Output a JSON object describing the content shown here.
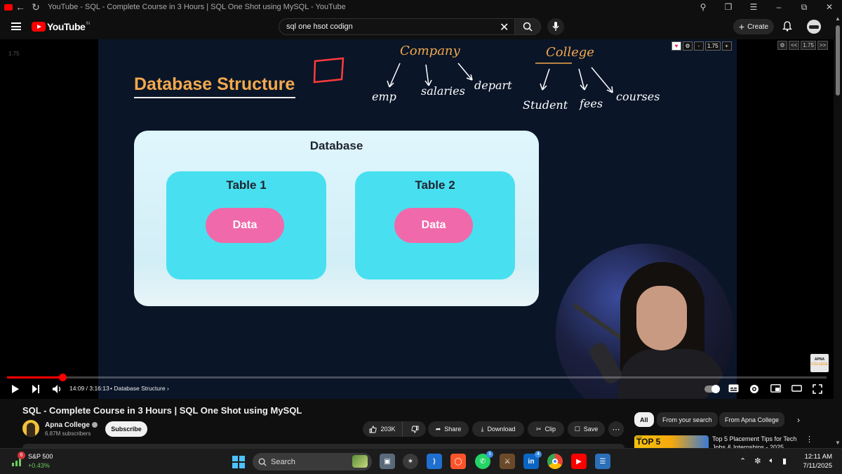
{
  "browser": {
    "title": "YouTube - SQL - Complete Course in 3 Hours | SQL One Shot using MySQL - YouTube"
  },
  "header": {
    "logo_text": "YouTube",
    "logo_region": "IN",
    "search_value": "sql one hsot codign",
    "create_label": "Create"
  },
  "player": {
    "left_speed": "1.75",
    "slide": {
      "title": "Database Structure",
      "database_label": "Database",
      "tables": [
        {
          "label": "Table 1",
          "data_label": "Data"
        },
        {
          "label": "Table 2",
          "data_label": "Data"
        }
      ],
      "annotations": {
        "company": "Company",
        "company_items": [
          "emp",
          "salaries",
          "depart"
        ],
        "college": "College",
        "college_items": [
          "Student",
          "fees",
          "courses"
        ]
      }
    },
    "pen_tools": {
      "minus": "-",
      "speed": "1.75",
      "plus": "+"
    },
    "pen_tools_right": {
      "prev": "<<",
      "speed": "1.75",
      "next": ">>"
    },
    "channel_watermark": {
      "line1": "APNA",
      "line2": "COLLEGE"
    },
    "progress_fraction": 0.0675,
    "time": "14:09 / 3:16:13",
    "chapter": "• Database Structure"
  },
  "video": {
    "title": "SQL - Complete Course in 3 Hours | SQL One Shot using MySQL",
    "channel": "Apna College",
    "subscribers": "6.87M subscribers",
    "subscribe_label": "Subscribe",
    "likes": "203K",
    "share_label": "Share",
    "download_label": "Download",
    "clip_label": "Clip",
    "save_label": "Save"
  },
  "recommendations": {
    "chips": [
      "All",
      "From your search",
      "From Apna College"
    ],
    "first": {
      "thumb_text": "TOP 5",
      "thumb_year": "2025",
      "title": "Top 5 Placement Tips for Tech Jobs & Internships - 2025"
    }
  },
  "taskbar": {
    "stock_badge": "6",
    "stock_name": "S&P 500",
    "stock_change": "+0.43%",
    "search_label": "Search",
    "whatsapp_badge": "1",
    "linkedin_badge": "4",
    "time": "12:11 AM",
    "date": "7/11/2025"
  },
  "colors": {
    "accent_red": "#ff0000",
    "slide_title": "#f2a94c",
    "table_fill": "#48e0f0",
    "data_pill": "#f06aab"
  }
}
